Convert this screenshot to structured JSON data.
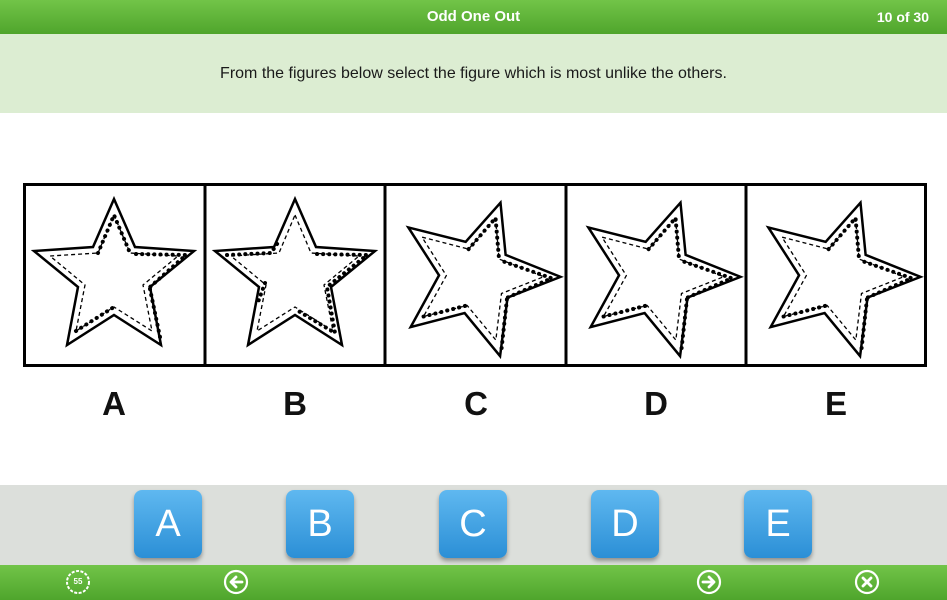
{
  "header": {
    "title": "Odd One Out",
    "progress": "10 of 30"
  },
  "question": {
    "instruction": "From the figures below select the figure which is most unlike the others."
  },
  "figures": {
    "labels": [
      "A",
      "B",
      "C",
      "D",
      "E"
    ],
    "rotations_deg": [
      0,
      0,
      18,
      18,
      18
    ]
  },
  "answers": {
    "options": [
      "A",
      "B",
      "C",
      "D",
      "E"
    ]
  },
  "footer": {
    "timer": "55",
    "prev_icon": "arrow-left-icon",
    "next_icon": "arrow-right-icon",
    "close_icon": "close-icon"
  },
  "colors": {
    "bar_green": "#5cb335",
    "instruction_bg": "#dcedd2",
    "answer_blue": "#3d9fe3",
    "answer_panel": "#dcdfdb"
  }
}
